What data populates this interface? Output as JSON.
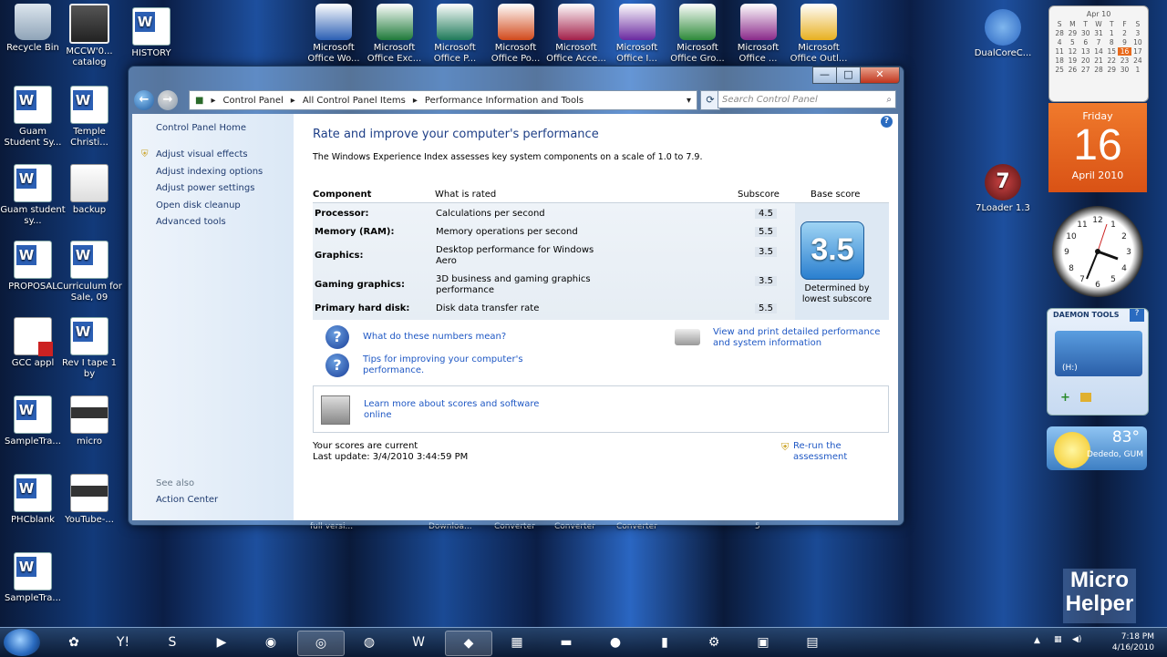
{
  "desktop_icons": [
    {
      "label": "Recycle Bin",
      "type": "bin"
    },
    {
      "label": "MCCW'0... catalog",
      "type": "photo"
    },
    {
      "label": "HISTORY",
      "type": "word"
    },
    {
      "label": "Guam Student Sy...",
      "type": "word"
    },
    {
      "label": "Temple Christi...",
      "type": "word"
    },
    {
      "label": "Guam student sy...",
      "type": "word"
    },
    {
      "label": "backup",
      "type": "folder"
    },
    {
      "label": "PROPOSAL",
      "type": "word"
    },
    {
      "label": "Curriculum for Sale, 09",
      "type": "word"
    },
    {
      "label": "GCC appl",
      "type": "pdf"
    },
    {
      "label": "Rev I tape 1 by",
      "type": "word"
    },
    {
      "label": "SampleTra...",
      "type": "word"
    },
    {
      "label": "micro",
      "type": "screen"
    },
    {
      "label": "PHCblank",
      "type": "word"
    },
    {
      "label": "YouTube-...",
      "type": "screen"
    },
    {
      "label": "SampleTra...",
      "type": "word"
    }
  ],
  "office_icons": [
    {
      "label": "Microsoft Office Wo...",
      "color": "#2b5fb4"
    },
    {
      "label": "Microsoft Office Exc...",
      "color": "#1f7a3a"
    },
    {
      "label": "Microsoft Office P...",
      "color": "#1f7a5a"
    },
    {
      "label": "Microsoft Office Po...",
      "color": "#d24a1c"
    },
    {
      "label": "Microsoft Office Acce...",
      "color": "#a3204a"
    },
    {
      "label": "Microsoft Office I...",
      "color": "#6a2aa0"
    },
    {
      "label": "Microsoft Office Gro...",
      "color": "#2e8a3a"
    },
    {
      "label": "Microsoft Office ...",
      "color": "#8a2a8a"
    },
    {
      "label": "Microsoft Office Outl...",
      "color": "#e8b020"
    }
  ],
  "right_desktop_icons": [
    {
      "label": "DualCoreC...",
      "type": "gears"
    },
    {
      "label": "7Loader 1.3",
      "type": "seven"
    }
  ],
  "window": {
    "controls": {
      "minimize": "—",
      "maximize": "□",
      "close": "✕"
    },
    "nav": {
      "back": "←",
      "forward": "→"
    },
    "breadcrumb": [
      "Control Panel",
      "All Control Panel Items",
      "Performance Information and Tools"
    ],
    "search_placeholder": "Search Control Panel",
    "help": "?"
  },
  "sidebar": {
    "home": "Control Panel Home",
    "tasks": [
      "Adjust visual effects",
      "Adjust indexing options",
      "Adjust power settings",
      "Open disk cleanup",
      "Advanced tools"
    ],
    "see_also": "See also",
    "action_center": "Action Center"
  },
  "main": {
    "title": "Rate and improve your computer's performance",
    "intro": "The Windows Experience Index assesses key system components on a scale of 1.0 to 7.9.",
    "headers": {
      "component": "Component",
      "rated": "What is rated",
      "subscore": "Subscore",
      "base": "Base score"
    },
    "rows": [
      {
        "component": "Processor:",
        "rated": "Calculations per second",
        "subscore": "4.5"
      },
      {
        "component": "Memory (RAM):",
        "rated": "Memory operations per second",
        "subscore": "5.5"
      },
      {
        "component": "Graphics:",
        "rated": "Desktop performance for Windows Aero",
        "subscore": "3.5"
      },
      {
        "component": "Gaming graphics:",
        "rated": "3D business and gaming graphics performance",
        "subscore": "3.5"
      },
      {
        "component": "Primary hard disk:",
        "rated": "Disk data transfer rate",
        "subscore": "5.5"
      }
    ],
    "base_score": "3.5",
    "base_label": "Determined by lowest subscore",
    "link_numbers": "What do these numbers mean?",
    "link_tips": "Tips for improving your computer's performance.",
    "link_print": "View and print detailed performance and system information",
    "link_learn": "Learn more about scores and software online",
    "status_current": "Your scores are current",
    "status_update": "Last update: 3/4/2010 3:44:59 PM",
    "rerun": "Re-run the assessment"
  },
  "calendar": {
    "month": "Apr 10",
    "days_header": [
      "S",
      "M",
      "T",
      "W",
      "T",
      "F",
      "S"
    ],
    "cells": [
      "28",
      "29",
      "30",
      "31",
      "1",
      "2",
      "3",
      "4",
      "5",
      "6",
      "7",
      "8",
      "9",
      "10",
      "11",
      "12",
      "13",
      "14",
      "15",
      "16",
      "17",
      "18",
      "19",
      "20",
      "21",
      "22",
      "23",
      "24",
      "25",
      "26",
      "27",
      "28",
      "29",
      "30",
      "1"
    ],
    "today": "16",
    "weekday": "Friday",
    "date": "16",
    "month_year": "April 2010"
  },
  "daemon": {
    "title": "DAEMON TOOLS",
    "drive": "(H:)"
  },
  "weather": {
    "temp": "83°",
    "location": "Dededo, GUM"
  },
  "watermark": {
    "line1": "Micro",
    "line2": "Helper"
  },
  "taskbar": {
    "time": "7:18 PM",
    "date": "4/16/2010",
    "apps": [
      "✿",
      "Y!",
      "S",
      "▶",
      "◉",
      "◎",
      "◍",
      "W",
      "◆",
      "▦",
      "▬",
      "●",
      "▮",
      "⚙",
      "▣",
      "▤"
    ]
  },
  "behind_window_labels": [
    "full versi...",
    "Downloa...",
    "Converter",
    "Converter",
    "Converter",
    "5"
  ]
}
